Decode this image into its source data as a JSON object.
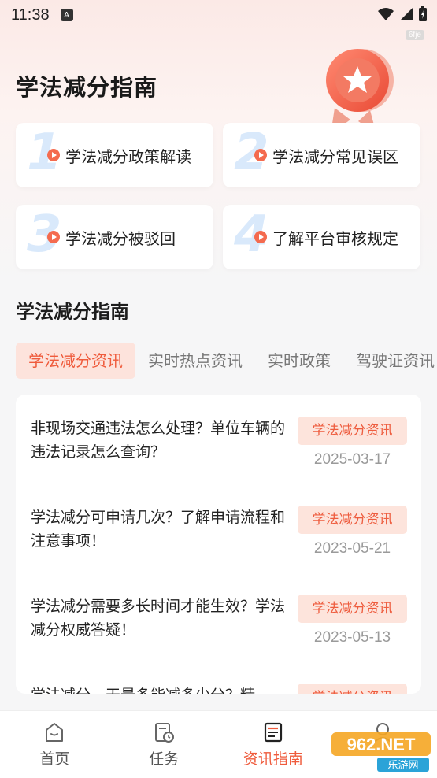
{
  "status_bar": {
    "time": "11:38",
    "notification_badge": "A",
    "watermark": "6fje"
  },
  "hero": {
    "title": "学法减分指南"
  },
  "guide_cards": [
    {
      "number": "1",
      "label": "学法减分政策解读"
    },
    {
      "number": "2",
      "label": "学法减分常见误区"
    },
    {
      "number": "3",
      "label": "学法减分被驳回"
    },
    {
      "number": "4",
      "label": "了解平台审核规定"
    }
  ],
  "section": {
    "title": "学法减分指南"
  },
  "tabs": [
    {
      "label": "学法减分资讯",
      "active": true
    },
    {
      "label": "实时热点资讯",
      "active": false
    },
    {
      "label": "实时政策",
      "active": false
    },
    {
      "label": "驾驶证资讯",
      "active": false
    }
  ],
  "news": [
    {
      "headline": "非现场交通违法怎么处理？单位车辆的违法记录怎么查询？",
      "tag": "学法减分资讯",
      "date": "2025-03-17"
    },
    {
      "headline": "学法减分可申请几次？了解申请流程和注意事项！",
      "tag": "学法减分资讯",
      "date": "2023-05-21"
    },
    {
      "headline": "学法减分需要多长时间才能生效？学法减分权威答疑！",
      "tag": "学法减分资讯",
      "date": "2023-05-13"
    },
    {
      "headline": "学法减分一天最多能减多少分？精",
      "tag": "学法减分资讯",
      "date": ""
    }
  ],
  "bottom_nav": [
    {
      "label": "首页",
      "icon": "home-icon",
      "active": false
    },
    {
      "label": "任务",
      "icon": "task-icon",
      "active": false
    },
    {
      "label": "资讯指南",
      "icon": "news-guide-icon",
      "active": true
    },
    {
      "label": "我的",
      "icon": "profile-icon",
      "active": false
    }
  ],
  "site_logo": {
    "text": "962.NET",
    "subtext": "乐游网"
  },
  "colors": {
    "accent": "#ef5b3c",
    "tag_bg": "#fde4dc",
    "digit_blue": "#d9e9fb"
  }
}
